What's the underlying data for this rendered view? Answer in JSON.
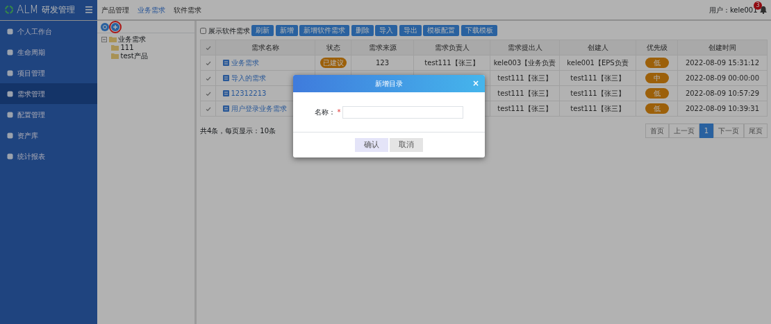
{
  "app": {
    "logo": "ALM",
    "title": "研发管理"
  },
  "top_tabs": [
    {
      "label": "产品管理",
      "selected": false
    },
    {
      "label": "业务需求",
      "selected": true
    },
    {
      "label": "软件需求",
      "selected": false
    }
  ],
  "user": {
    "label": "用户：kele001",
    "badge": "3"
  },
  "sidebar": {
    "items": [
      {
        "label": "个人工作台",
        "selected": false
      },
      {
        "label": "生命周期",
        "selected": false
      },
      {
        "label": "项目管理",
        "selected": false
      },
      {
        "label": "需求管理",
        "selected": true
      },
      {
        "label": "配置管理",
        "selected": false
      },
      {
        "label": "资产库",
        "selected": false
      },
      {
        "label": "统计报表",
        "selected": false
      }
    ]
  },
  "tree": {
    "buttons": [
      {
        "highlighted": false
      },
      {
        "highlighted": true
      }
    ],
    "nodes": [
      {
        "label": "业务需求",
        "expanded": true,
        "children": [
          {
            "label": "111"
          },
          {
            "label": "test产品"
          }
        ]
      }
    ]
  },
  "toolbar": {
    "show_software": {
      "label": "展示软件需求",
      "checked": false
    },
    "buttons": [
      "刷新",
      "新增",
      "新增软件需求",
      "删除",
      "导入",
      "导出",
      "模板配置",
      "下载模板"
    ]
  },
  "table": {
    "columns": [
      "需求名称",
      "状态",
      "需求来源",
      "需求负责人",
      "需求提出人",
      "创建人",
      "优先级",
      "创建时间"
    ],
    "rows": [
      {
        "name": "业务需求",
        "status": "已建议",
        "source": "123",
        "owner": "test111【张三】",
        "proposer": "kele003【业务负责",
        "creator": "kele001【EPS负责",
        "priority": "低",
        "created": "2022-08-09 15:31:12"
      },
      {
        "name": "导入的需求",
        "proposer": "test111【张三】",
        "creator": "test111【张三】",
        "priority": "中",
        "created": "2022-08-09 00:00:00"
      },
      {
        "name": "12312213",
        "proposer": "test111【张三】",
        "creator": "test111【张三】",
        "priority": "低",
        "created": "2022-08-09 10:57:29"
      },
      {
        "name": "用户登录业务需求",
        "proposer": "test111【张三】",
        "creator": "test111【张三】",
        "priority": "低",
        "created": "2022-08-09 10:39:31"
      }
    ]
  },
  "footer": {
    "summary": "共4条，每页显示：10条",
    "pages": [
      {
        "label": "首页",
        "selected": false
      },
      {
        "label": "上一页",
        "selected": false
      },
      {
        "label": "1",
        "selected": true
      },
      {
        "label": "下一页",
        "selected": false
      },
      {
        "label": "尾页",
        "selected": false
      }
    ]
  },
  "dialog": {
    "title": "新增目录",
    "close": "×",
    "field_label": "名称：",
    "required": "*",
    "buttons": [
      "确认",
      "取消"
    ]
  }
}
